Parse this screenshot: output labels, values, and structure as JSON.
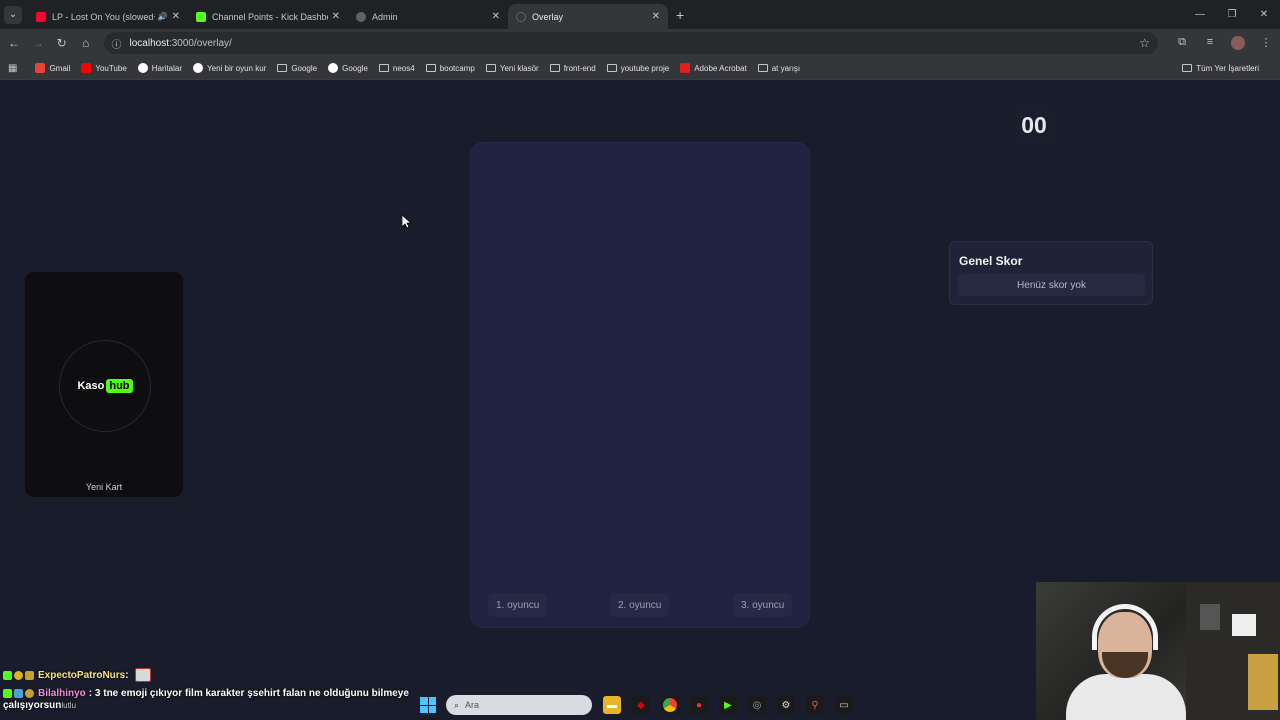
{
  "browser": {
    "tabs": [
      {
        "title": "LP - Lost On You (slowed+rev",
        "active": false,
        "fav_color": "#ff0033"
      },
      {
        "title": "Channel Points - Kick Dashboard",
        "active": false,
        "fav_color": "#53fc18"
      },
      {
        "title": "Admin",
        "active": false,
        "fav_color": "#5f6368"
      },
      {
        "title": "Overlay",
        "active": true,
        "fav_color": "#5f6368"
      }
    ],
    "url_host": "localhost",
    "url_path": ":3000/overlay/",
    "bookmarks": [
      {
        "label": "Gmail",
        "icon": "gmail-icon",
        "color": "#ea4335"
      },
      {
        "label": "YouTube",
        "icon": "youtube-icon",
        "color": "#ff0000"
      },
      {
        "label": "Haritalar",
        "icon": "maps-icon",
        "color": "#ffffff"
      },
      {
        "label": "Yeni bir oyun kur",
        "icon": "globe-icon",
        "color": "#ffffff"
      },
      {
        "label": "Google",
        "icon": "folder-icon",
        "color": "#c4c7c5"
      },
      {
        "label": "Google",
        "icon": "google-icon",
        "color": "#ffffff"
      },
      {
        "label": "neos4",
        "icon": "folder-icon",
        "color": "#c4c7c5"
      },
      {
        "label": "bootcamp",
        "icon": "folder-icon",
        "color": "#c4c7c5"
      },
      {
        "label": "Yeni klasör",
        "icon": "folder-icon",
        "color": "#c4c7c5"
      },
      {
        "label": "front-end",
        "icon": "folder-icon",
        "color": "#c4c7c5"
      },
      {
        "label": "youtube proje",
        "icon": "folder-icon",
        "color": "#c4c7c5"
      },
      {
        "label": "Adobe Acrobat",
        "icon": "acrobat-icon",
        "color": "#e02020"
      },
      {
        "label": "at yarışı",
        "icon": "folder-icon",
        "color": "#c4c7c5"
      }
    ],
    "all_bookmarks": "Tüm Yer İşaretleri"
  },
  "overlay": {
    "timer": "00",
    "card": {
      "logo_main": "Kaso",
      "logo_hub": "hub",
      "label": "Yeni Kart"
    },
    "players": [
      "1. oyuncu",
      "2. oyuncu",
      "3. oyuncu"
    ],
    "score": {
      "title": "Genel Skor",
      "empty": "Henüz skor yok"
    }
  },
  "chat": {
    "line1": {
      "user": "ExpectoPatroNurs",
      "sep": " :"
    },
    "line2": {
      "user": "Bilalhinyo",
      "text": ": 3 tne emoji çıkıyor film karakter şsehirt falan ne olduğunu bilmeye",
      "cont": "çalışıyorsun",
      "cont2": "lutlu"
    }
  },
  "taskbar": {
    "search_placeholder": "Ara"
  },
  "colors": {
    "background": "#191c2a",
    "stage": "#1f2340",
    "kick_green": "#53fc18"
  }
}
